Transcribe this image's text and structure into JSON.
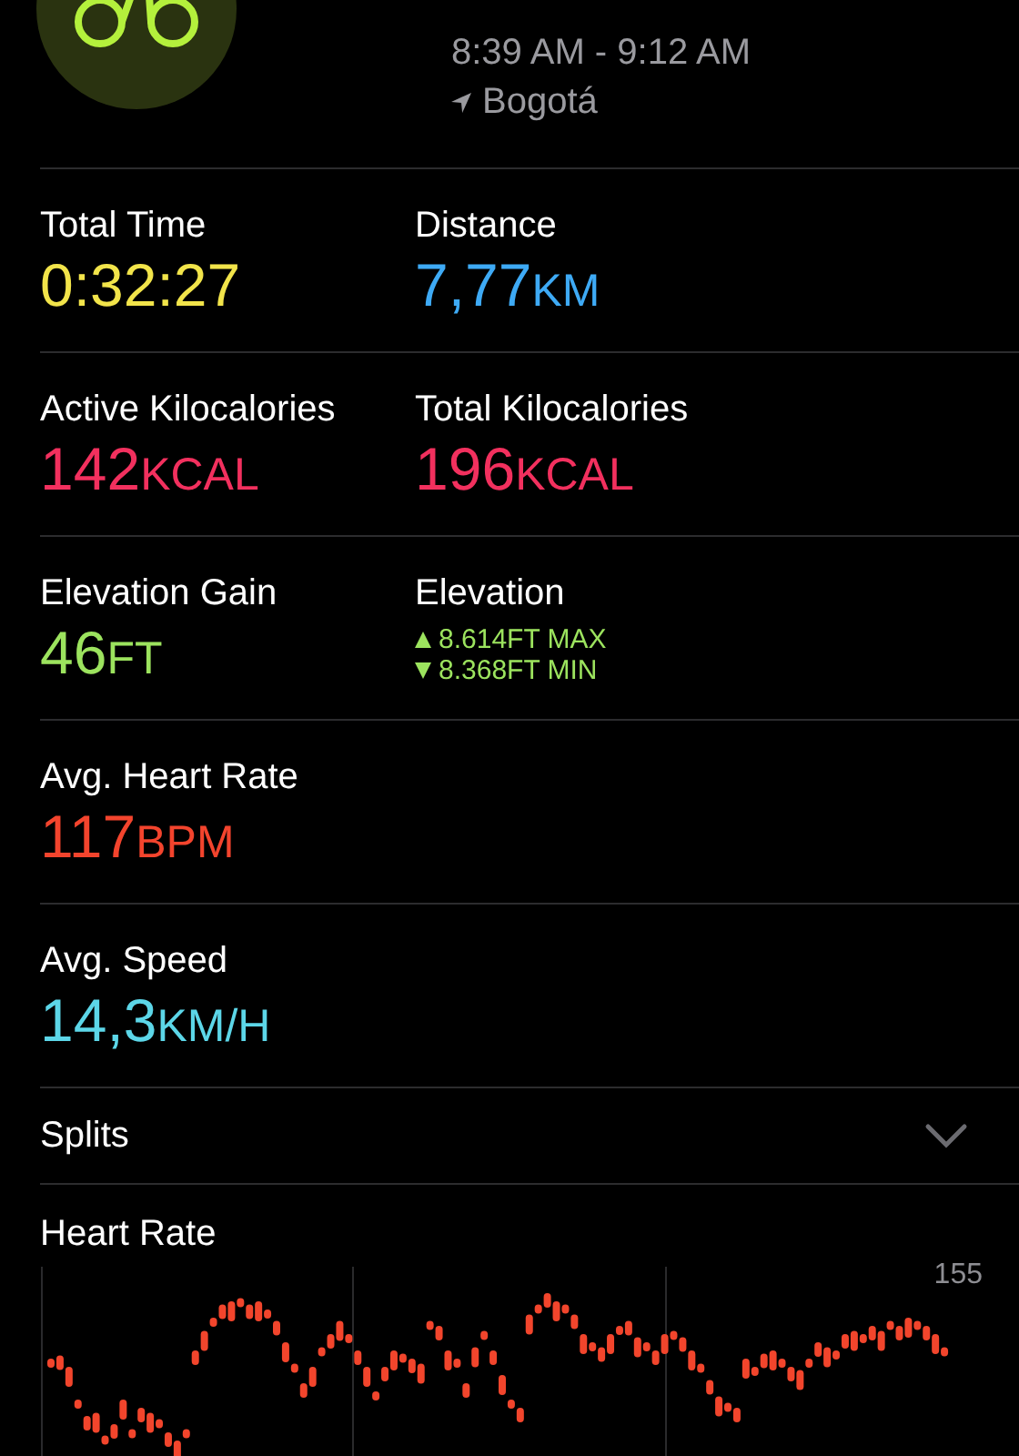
{
  "header": {
    "time_range": "8:39 AM - 9:12 AM",
    "location": "Bogotá"
  },
  "metric_rows": [
    {
      "cells": [
        {
          "kind": "metric",
          "label": "Total Time",
          "value": "0:32:27",
          "color": "#f2e44a"
        },
        {
          "kind": "metric",
          "label": "Distance",
          "value": "7,77",
          "unit": "KM",
          "color": "#3eaaf5"
        }
      ]
    },
    {
      "cells": [
        {
          "kind": "metric",
          "label": "Active Kilocalories",
          "value": "142",
          "unit": "KCAL",
          "color": "#f2305e"
        },
        {
          "kind": "metric",
          "label": "Total Kilocalories",
          "value": "196",
          "unit": "KCAL",
          "color": "#f2305e"
        }
      ]
    },
    {
      "cells": [
        {
          "kind": "metric",
          "label": "Elevation Gain",
          "value": "46",
          "unit": "FT",
          "color": "#9ce35e"
        },
        {
          "kind": "range",
          "label": "Elevation",
          "max": "8.614FT MAX",
          "min": "8.368FT MIN",
          "color": "#9ce35e"
        }
      ]
    },
    {
      "cells": [
        {
          "kind": "metric",
          "label": "Avg. Heart Rate",
          "value": "117",
          "unit": "BPM",
          "color": "#f3442d"
        }
      ]
    },
    {
      "cells": [
        {
          "kind": "metric",
          "label": "Avg. Speed",
          "value": "14,3",
          "unit": "KM/H",
          "color": "#5cd6e8"
        }
      ]
    }
  ],
  "splits": {
    "label": "Splits",
    "expanded": false
  },
  "heart_rate": {
    "title": "Heart Rate",
    "max_label": "155"
  }
}
